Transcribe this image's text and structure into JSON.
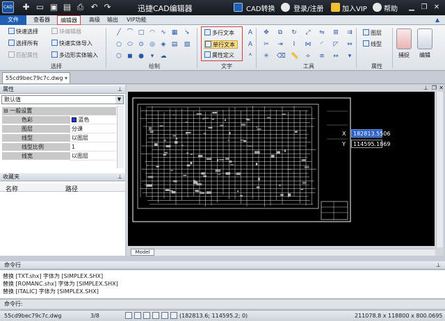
{
  "app": {
    "title": "迅捷CAD编辑器",
    "logo_text": "CAD"
  },
  "titlebar": {
    "quick_icons": [
      "new-icon",
      "open-icon",
      "save-icon",
      "save-as-icon",
      "print-icon",
      "undo-icon",
      "redo-icon"
    ],
    "cad_convert_label": "CAD转换",
    "login_label": "登录/注册",
    "vip_label": "加入VIP",
    "help_label": "帮助",
    "window_icons": [
      "minimize-icon",
      "restore-icon",
      "close-icon"
    ]
  },
  "menu": {
    "items": [
      "文件",
      "查看器",
      "编辑器",
      "高级",
      "输出",
      "VIP功能"
    ],
    "active": "编辑器"
  },
  "ribbon": {
    "select_group": {
      "label": "选择",
      "items": [
        {
          "label": "快速选择",
          "enabled": true
        },
        {
          "label": "块编辑器",
          "enabled": false
        },
        {
          "label": "选择所有",
          "enabled": true
        },
        {
          "label": "快速实体导入",
          "enabled": true
        },
        {
          "label": "匹配属性",
          "enabled": false
        },
        {
          "label": "多边形实体输入",
          "enabled": true
        }
      ]
    },
    "draw_group": {
      "label": "绘制"
    },
    "text_group": {
      "label": "文字",
      "items": [
        {
          "label": "多行文本"
        },
        {
          "label": "单行文本"
        },
        {
          "label": "属性定义"
        }
      ]
    },
    "tools_group": {
      "label": "工具"
    },
    "attributes_group": {
      "label": "属性",
      "items": [
        {
          "label": "图层"
        },
        {
          "label": "线型"
        }
      ]
    },
    "big_buttons": [
      {
        "label": "捕捉"
      },
      {
        "label": "编辑"
      }
    ]
  },
  "document": {
    "tab_name": "55cd9bec79c7c.dwg"
  },
  "properties_panel": {
    "title": "属性",
    "combo_value": "默认值",
    "section": "一般设置",
    "rows": [
      {
        "key": "色彩",
        "value": "蓝色",
        "swatch": "#1e3cff"
      },
      {
        "key": "图层",
        "value": "分课"
      },
      {
        "key": "线型",
        "value": "以图层"
      },
      {
        "key": "线型比例",
        "value": "1"
      },
      {
        "key": "线宽",
        "value": "以图层"
      }
    ]
  },
  "favorites_panel": {
    "title": "收藏夹",
    "col_name": "名称",
    "col_path": "路径"
  },
  "canvas": {
    "coord_x_label": "X",
    "coord_x_value": "182813.5506",
    "coord_y_label": "Y",
    "coord_y_value": "114595.1869",
    "model_tab": "Model"
  },
  "command": {
    "title": "命令行",
    "lines": [
      "替换 [TXT.shx] 字体为 [SIMPLEX.SHX]",
      "替换 [ROMANC.shx] 字体为 [SIMPLEX.SHX]",
      "替换 [ITALIC] 字体为 [SIMPLEX.SHX]"
    ],
    "input_label": "命令行:"
  },
  "status": {
    "file": "55cd9bec79c7c.dwg",
    "page": "3/8",
    "coords": "(182813.6; 114595.2; 0)",
    "size": "211078.8 x 118800 x 800.0695"
  }
}
